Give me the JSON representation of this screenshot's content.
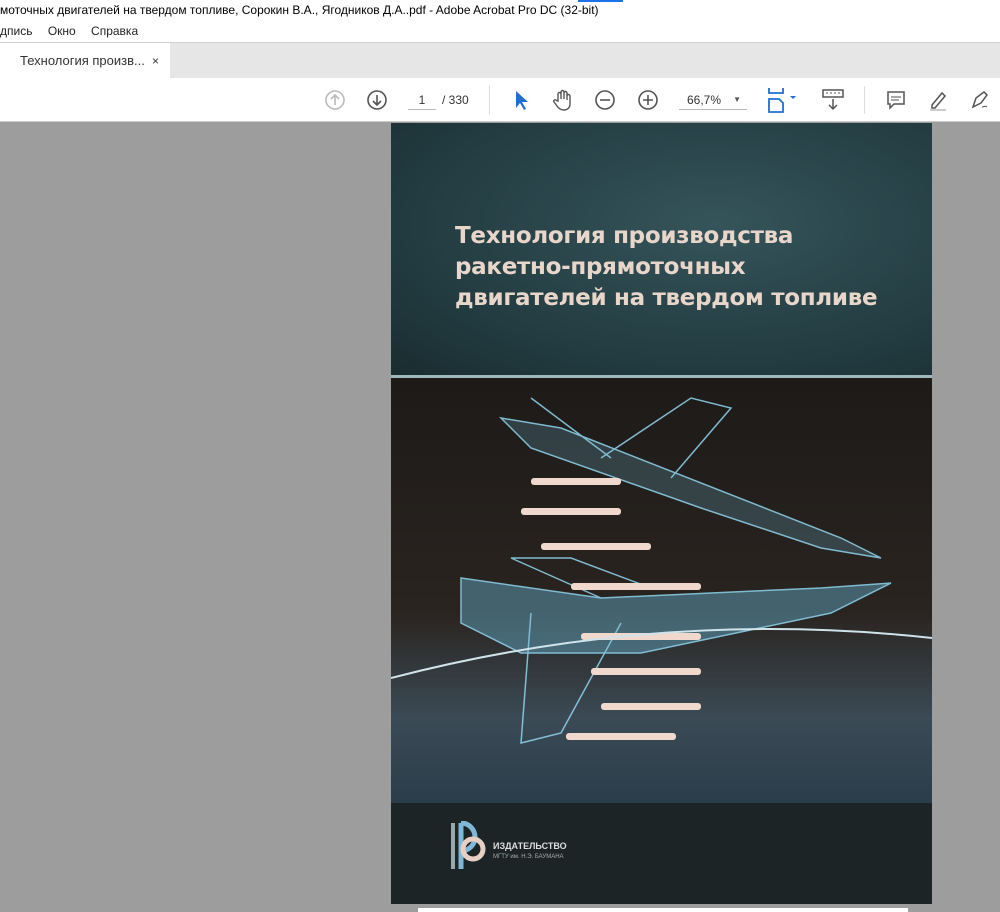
{
  "window": {
    "title": "моточных двигателей на твердом топливе, Сорокин В.А., Ягодников Д.А..pdf - Adobe Acrobat Pro DC (32-bit)"
  },
  "menu": [
    "дпись",
    "Окно",
    "Справка"
  ],
  "tab": {
    "label": "Технология произв...",
    "close": "×"
  },
  "toolbar": {
    "page_current": "1",
    "page_total": "/ 330",
    "zoom": "66,7%"
  },
  "document": {
    "title_lines": [
      "Технология производства",
      "ракетно-прямоточных",
      "двигателей на твердом топливе"
    ],
    "publisher_line1": "ИЗДАТЕЛЬСТВО",
    "publisher_line2": "МГТУ им. Н.Э. БАУМАНА"
  }
}
